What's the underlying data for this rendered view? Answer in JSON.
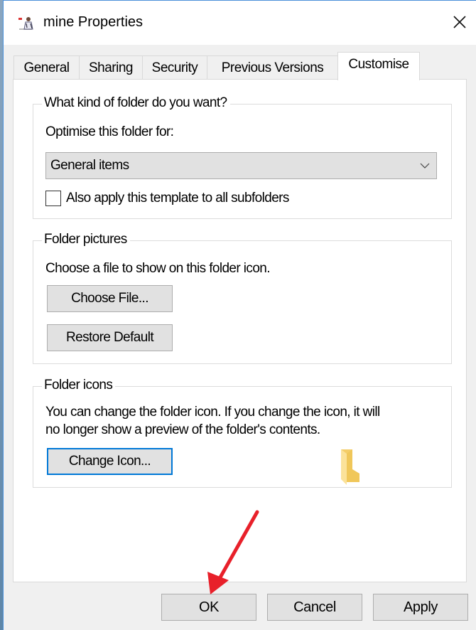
{
  "window": {
    "title": "mine Properties",
    "title_icon": "folder-user-icon",
    "close_icon": "close-icon"
  },
  "tabs": [
    {
      "label": "General",
      "active": false
    },
    {
      "label": "Sharing",
      "active": false
    },
    {
      "label": "Security",
      "active": false
    },
    {
      "label": "Previous Versions",
      "active": false
    },
    {
      "label": "Customise",
      "active": true
    }
  ],
  "folder_type": {
    "legend": "What kind of folder do you want?",
    "optimise_label": "Optimise this folder for:",
    "selected_option": "General items",
    "apply_subfolders_label": "Also apply this template to all subfolders",
    "apply_subfolders_checked": false
  },
  "folder_pictures": {
    "legend": "Folder pictures",
    "description": "Choose a file to show on this folder icon.",
    "choose_file_label": "Choose File...",
    "restore_default_label": "Restore Default"
  },
  "folder_icons": {
    "legend": "Folder icons",
    "description_line1": "You can change the folder icon. If you change the icon, it will",
    "description_line2": "no longer show a preview of the folder's contents.",
    "change_icon_label": "Change Icon...",
    "preview_icon": "folder-icon"
  },
  "footer": {
    "ok_label": "OK",
    "cancel_label": "Cancel",
    "apply_label": "Apply"
  },
  "annotation": {
    "type": "arrow",
    "color": "#e8202a",
    "points_to": "ok-button"
  },
  "colors": {
    "accent": "#0078d7",
    "button_face": "#e1e1e1",
    "dialog_bg": "#f0f0f0",
    "folder_yellow": "#f8d775"
  }
}
